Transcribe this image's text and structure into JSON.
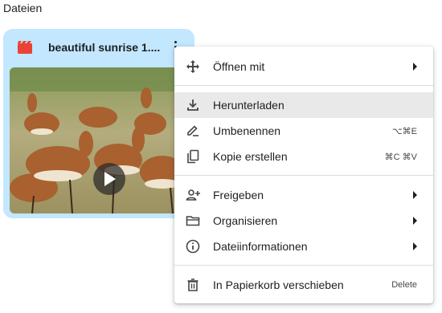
{
  "section": {
    "title": "Dateien"
  },
  "file_card": {
    "title": "beautiful sunrise 1....",
    "type_icon": "video-file-icon",
    "colors": {
      "card_bg": "#c2e7ff",
      "video_icon": "#ea4335"
    }
  },
  "context_menu": {
    "items": [
      {
        "label": "Öffnen mit",
        "icon": "open-with-icon",
        "shortcut": "",
        "submenu": true
      },
      {
        "label": "Herunterladen",
        "icon": "download-icon",
        "shortcut": "",
        "submenu": false
      },
      {
        "label": "Umbenennen",
        "icon": "rename-icon",
        "shortcut": "⌥⌘E",
        "submenu": false
      },
      {
        "label": "Kopie erstellen",
        "icon": "copy-icon",
        "shortcut": "⌘C ⌘V",
        "submenu": false
      },
      {
        "label": "Freigeben",
        "icon": "share-person-icon",
        "shortcut": "",
        "submenu": true
      },
      {
        "label": "Organisieren",
        "icon": "folder-icon",
        "shortcut": "",
        "submenu": true
      },
      {
        "label": "Dateiinformationen",
        "icon": "info-icon",
        "shortcut": "",
        "submenu": true
      },
      {
        "label": "In Papierkorb verschieben",
        "icon": "trash-icon",
        "shortcut": "Delete",
        "submenu": false
      }
    ],
    "hover_color": "#e9e9ea"
  }
}
